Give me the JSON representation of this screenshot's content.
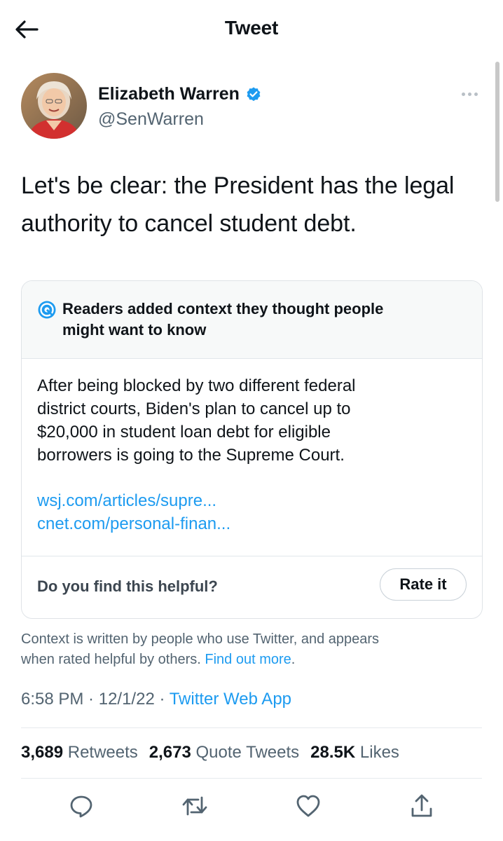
{
  "header": {
    "title": "Tweet",
    "back_icon": "arrow-left-icon"
  },
  "author": {
    "name": "Elizabeth Warren",
    "handle": "@SenWarren",
    "verified": true,
    "verified_color": "#1d9bf0"
  },
  "tweet": {
    "text": "Let's be clear: the President has the legal authority to cancel student debt."
  },
  "note": {
    "heading_line1": "Readers added context they thought people",
    "heading_line2": "might want to know",
    "body_line1": "After being blocked by two different federal",
    "body_line2": "district courts, Biden's plan to cancel up to",
    "body_line3": "$20,000 in student loan debt for eligible",
    "body_line4": "borrowers is going to the Supreme Court.",
    "links": [
      "wsj.com/articles/supre...",
      "cnet.com/personal-finan..."
    ],
    "helpful_question": "Do you find this helpful?",
    "rate_label": "Rate it"
  },
  "disclaimer": {
    "line1": "Context is written by people who use Twitter, and appears",
    "line2_prefix": "when rated helpful by others. ",
    "link": "Find out more",
    "suffix": "."
  },
  "meta": {
    "time": "6:58 PM",
    "sep1": " · ",
    "date": "12/1/22",
    "sep2": " · ",
    "client": "Twitter Web App"
  },
  "stats": {
    "retweets_count": "3,689",
    "retweets_label": "Retweets",
    "quotes_count": "2,673",
    "quotes_label": "Quote Tweets",
    "likes_count": "28.5K",
    "likes_label": "Likes"
  },
  "actions": [
    "reply-icon",
    "retweet-icon",
    "like-icon",
    "share-icon"
  ],
  "colors": {
    "link": "#1d9bf0",
    "secondary_text": "#536471",
    "primary_text": "#0f1419"
  }
}
